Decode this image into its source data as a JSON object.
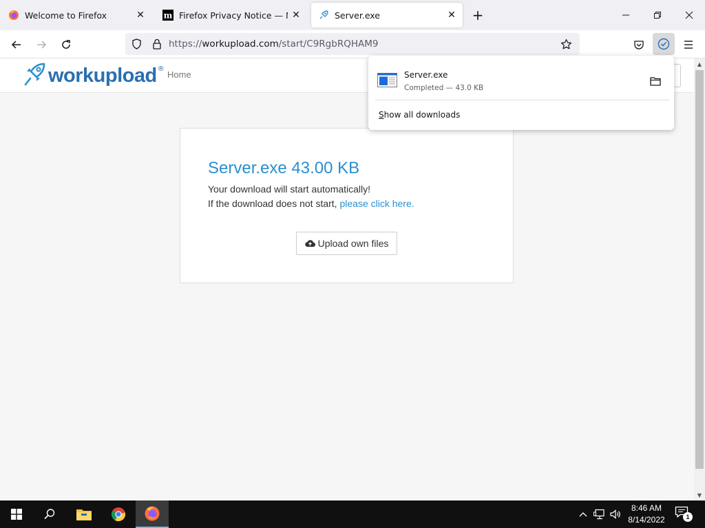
{
  "browser": {
    "tabs": [
      {
        "title": "Welcome to Firefox",
        "favicon": "firefox-icon",
        "active": false
      },
      {
        "title": "Firefox Privacy Notice — Mozill",
        "favicon": "mozilla-m-icon",
        "active": false
      },
      {
        "title": "Server.exe",
        "favicon": "rocket-icon",
        "active": true
      }
    ],
    "url": {
      "scheme": "https://",
      "host": "workupload.com",
      "path": "/start/C9RgbRQHAM9"
    }
  },
  "downloads_panel": {
    "file_name": "Server.exe",
    "status": "Completed — 43.0 KB",
    "show_all_label": "Show all downloads",
    "show_all_accesskey": "S",
    "show_all_rest": "how all downloads"
  },
  "site": {
    "logo_text": "workupload",
    "logo_reg": "®",
    "nav_home": "Home",
    "brand_color": "#2a6fb0",
    "card": {
      "title": "Server.exe 43.00 KB",
      "line1": "Your download will start automatically!",
      "line2_prefix": "If the download does not start, ",
      "line2_link": "please click here.",
      "upload_button": "Upload own files"
    }
  },
  "taskbar": {
    "time": "8:46 AM",
    "date": "8/14/2022",
    "notification_count": "1"
  }
}
